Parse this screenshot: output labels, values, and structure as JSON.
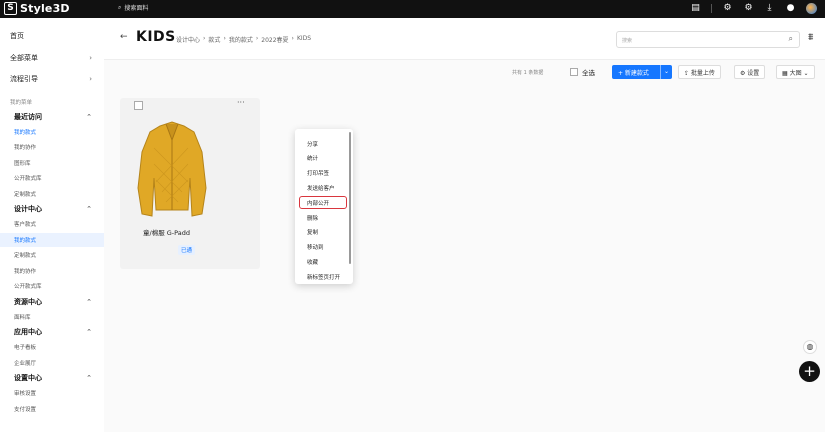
{
  "app": {
    "logo_text": "Style3D",
    "logo_glyph": "S"
  },
  "topbar": {
    "search_placeholder": "搜索面料",
    "search_glyph": "⌕",
    "icons": [
      "calendar-icon",
      "settings-icon",
      "notification-icon",
      "download-icon",
      "message-icon",
      "avatar"
    ]
  },
  "sidebar": {
    "top": [
      {
        "label": "首页",
        "chev": ""
      },
      {
        "label": "全部菜单",
        "chev": "›"
      },
      {
        "label": "流程引导",
        "chev": "›"
      }
    ],
    "section_label": "我的菜单",
    "groups": [
      {
        "label": "最近访问",
        "chev": "⌃",
        "items": [
          "我的款式",
          "我的协作",
          "图形库",
          "公开款式库",
          "定制款式"
        ]
      },
      {
        "label": "设计中心",
        "chev": "⌃",
        "items": [
          "客户款式",
          "我的款式",
          "定制款式",
          "我的协作",
          "公开款式库"
        ]
      },
      {
        "label": "资源中心",
        "chev": "⌃",
        "items": [
          "面料库"
        ]
      },
      {
        "label": "应用中心",
        "chev": "⌃",
        "items": [
          "电子看板",
          "企业展厅"
        ]
      },
      {
        "label": "设置中心",
        "chev": "⌃",
        "items": [
          "审核设置",
          "支付设置"
        ]
      }
    ]
  },
  "header": {
    "back_glyph": "←",
    "title": "KIDS",
    "breadcrumbs": [
      "设计中心",
      "›",
      "款式",
      "›",
      "我的款式",
      "›",
      "2022春夏",
      "›",
      "KIDS"
    ],
    "search_placeholder": "搜索",
    "search_glyph": "⌕",
    "filter_glyph": "⩩"
  },
  "toolbar": {
    "count_text": "共有 1 条数据",
    "select_all": "全选",
    "new_style": "+ 新建款式",
    "new_style_dd": "⌄",
    "bulk_upload": "⇪ 批量上传",
    "settings": "⚙ 设置",
    "view": "▦ 大图 ⌄"
  },
  "card": {
    "more": "···",
    "title": "童/棉服 G-Padd",
    "badge": "已通"
  },
  "menu": {
    "items": [
      "分享",
      "统计",
      "打印吊签",
      "发送给客户",
      "内部公开",
      "删除",
      "复制",
      "移动到",
      "收藏",
      "新标签页打开"
    ],
    "selected_index": 4
  },
  "floating": {
    "help_glyph": "◍",
    "add_glyph": "+"
  },
  "colors": {
    "primary": "#1677ff",
    "topbar": "#111111",
    "highlight_border": "#d9363e",
    "jacket": "#e0a826"
  }
}
